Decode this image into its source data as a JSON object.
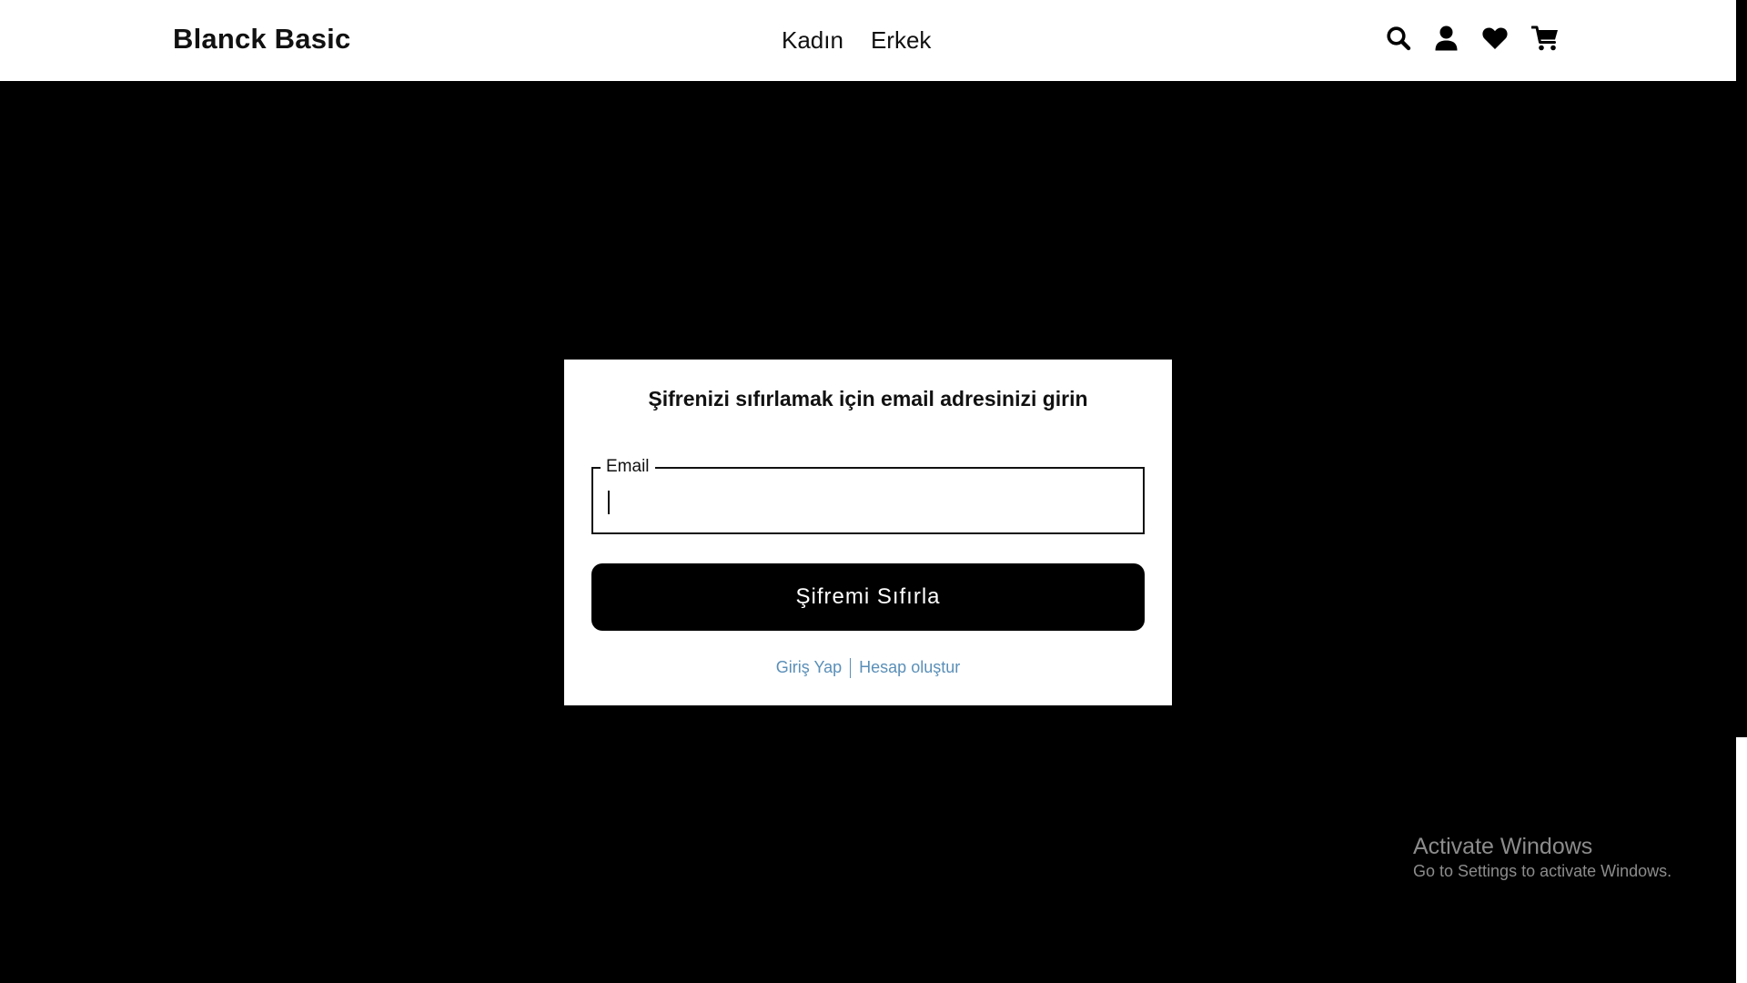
{
  "header": {
    "brand": "Blanck Basic",
    "nav": [
      {
        "label": "Kadın"
      },
      {
        "label": "Erkek"
      }
    ],
    "icons": [
      "search-icon",
      "user-icon",
      "heart-icon",
      "cart-icon"
    ]
  },
  "form": {
    "title": "Şifrenizi sıfırlamak için email adresinizi girin",
    "email_label": "Email",
    "email_value": "",
    "submit_label": "Şifremi Sıfırla",
    "login_link": "Giriş Yap",
    "register_link": "Hesap oluştur"
  },
  "watermark": {
    "title": "Activate Windows",
    "subtitle": "Go to Settings to activate Windows."
  },
  "colors": {
    "background": "#000000",
    "header_bg": "#ffffff",
    "card_bg": "#ffffff",
    "button_bg": "#000000",
    "link": "#5a8fb8",
    "watermark": "#8c8c8c"
  }
}
